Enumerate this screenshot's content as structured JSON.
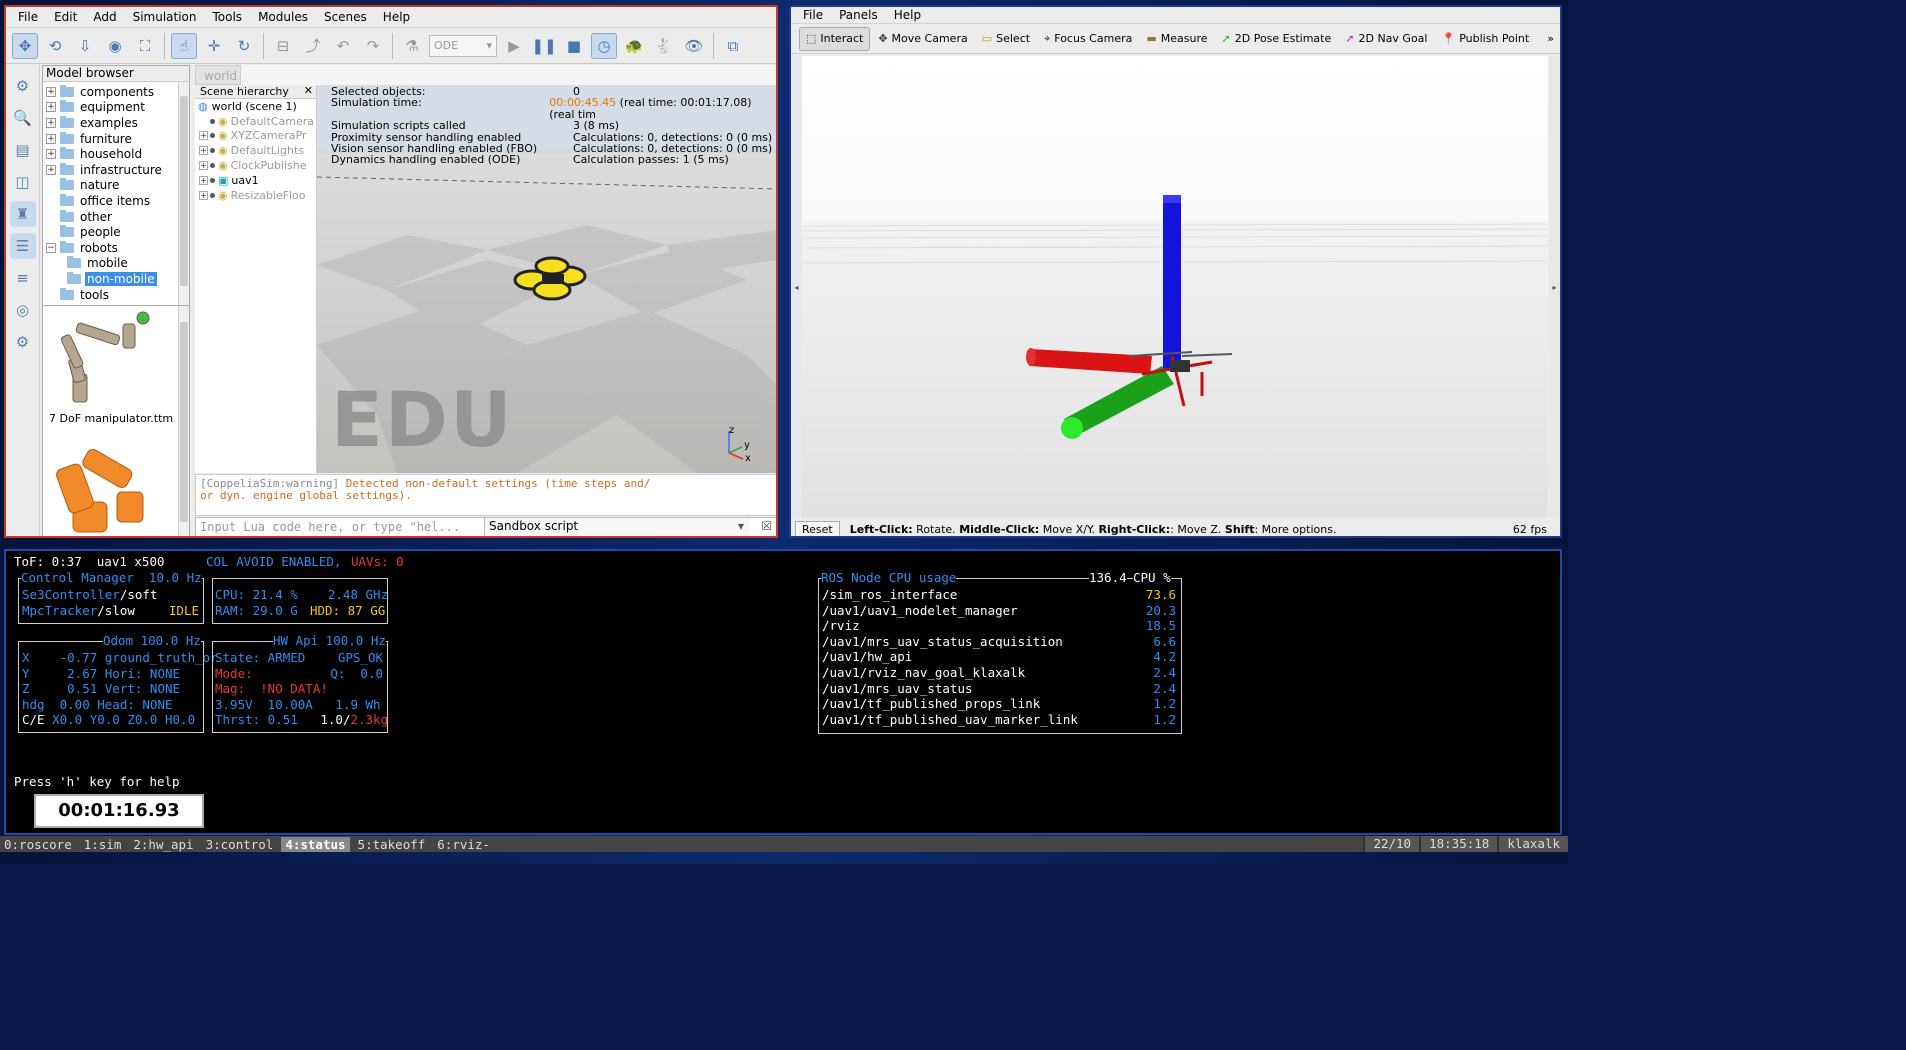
{
  "coppelia": {
    "menu": [
      "File",
      "Edit",
      "Add",
      "Simulation",
      "Tools",
      "Modules",
      "Scenes",
      "Help"
    ],
    "engine": "ODE",
    "model_browser": {
      "title": "Model browser",
      "items": [
        {
          "label": "components",
          "exp": "+"
        },
        {
          "label": "equipment",
          "exp": "+"
        },
        {
          "label": "examples",
          "exp": "+"
        },
        {
          "label": "furniture",
          "exp": "+"
        },
        {
          "label": "household",
          "exp": "+"
        },
        {
          "label": "infrastructure",
          "exp": "+"
        },
        {
          "label": "nature",
          "exp": ""
        },
        {
          "label": "office items",
          "exp": ""
        },
        {
          "label": "other",
          "exp": ""
        },
        {
          "label": "people",
          "exp": ""
        },
        {
          "label": "robots",
          "exp": "−"
        },
        {
          "label": "mobile",
          "exp": "",
          "indent": true
        },
        {
          "label": "non-mobile",
          "exp": "",
          "indent": true,
          "selected": true
        },
        {
          "label": "tools",
          "exp": ""
        }
      ],
      "thumb_label": "7 DoF manipulator.ttm"
    },
    "scene_tab": "world",
    "hierarchy": {
      "title": "Scene hierarchy",
      "rows": [
        {
          "label": "world (scene 1)",
          "main": true
        },
        {
          "label": "DefaultCamera"
        },
        {
          "label": "XYZCameraPr"
        },
        {
          "label": "DefaultLights"
        },
        {
          "label": "ClockPublishe"
        },
        {
          "label": "uav1",
          "main": true
        },
        {
          "label": "ResizableFloo"
        }
      ]
    },
    "info": [
      {
        "k": "Selected objects:",
        "v": "0"
      },
      {
        "k": "Simulation time:",
        "v_orange": "00:00:45.45",
        "v": " (real time: 00:01:17.08) (real tim"
      },
      {
        "k": "Simulation scripts called",
        "v": "3 (8 ms)"
      },
      {
        "k": "Proximity sensor handling enabled",
        "v": "Calculations: 0, detections: 0 (0 ms)"
      },
      {
        "k": "Vision sensor handling enabled (FBO)",
        "v": "Calculations: 0, detections: 0 (0 ms)"
      },
      {
        "k": "Dynamics handling enabled (ODE)",
        "v": "Calculation passes: 1 (5 ms)"
      }
    ],
    "watermark": "EDU",
    "axes": {
      "z": "z",
      "y": "y",
      "x": "x"
    },
    "console_prefix": "[CoppeliaSim:warning]",
    "console_msg1": " Detected non-default settings (time steps and/",
    "console_msg2": "or dyn. engine global settings).",
    "lua_placeholder": "Input Lua code here, or type \"hel...",
    "sandbox": "Sandbox script"
  },
  "rviz": {
    "menu": [
      "File",
      "Panels",
      "Help"
    ],
    "tools": [
      {
        "label": "Interact",
        "icon": "cursor-icon"
      },
      {
        "label": "Move Camera",
        "icon": "move-camera-icon"
      },
      {
        "label": "Select",
        "icon": "select-icon"
      },
      {
        "label": "Focus Camera",
        "icon": "focus-icon"
      },
      {
        "label": "Measure",
        "icon": "ruler-icon"
      },
      {
        "label": "2D Pose Estimate",
        "icon": "pose-arrow-icon"
      },
      {
        "label": "2D Nav Goal",
        "icon": "nav-arrow-icon"
      },
      {
        "label": "Publish Point",
        "icon": "pin-icon"
      }
    ],
    "reset": "Reset",
    "help_parts": [
      [
        "b",
        "Left-Click:"
      ],
      [
        "t",
        " Rotate. "
      ],
      [
        "b",
        "Middle-Click:"
      ],
      [
        "t",
        " Move X/Y. "
      ],
      [
        "b",
        "Right-Click:"
      ],
      [
        "t",
        ": Move Z. "
      ],
      [
        "b",
        "Shift"
      ],
      [
        "t",
        ": More options."
      ]
    ],
    "fps": "62 fps"
  },
  "terminal": {
    "tof": "ToF: 0:37  uav1 x500",
    "colavoid": "COL AVOID ENABLED,",
    "uavs": "UAVs: 0",
    "control": {
      "title": "Control Manager  10.0 Hz",
      "c1": "Se3Controller",
      "c1s": "/soft",
      "c2": "MpcTracker",
      "c2s": "/slow",
      "state": "IDLE"
    },
    "sys": {
      "cpu": "CPU: 21.4 %    2.48 GHz",
      "ram": "RAM: 29.0 G",
      "hdd": "HDD: 87 GG"
    },
    "odom": {
      "title": "Odom 100.0 Hz",
      "rows": [
        "X    -0.77 ground_truth_or",
        "Y     2.67 Hori: NONE",
        "Z     0.51 Vert: NONE",
        "hdg  0.00 Head: NONE"
      ],
      "ce_label": "C/E",
      "ce": " X0.0 Y0.0 Z0.0 H0.0"
    },
    "hw": {
      "title": "HW Api 100.0 Hz",
      "state": "State: ARMED",
      "gps": "GPS_OK",
      "mode": "Mode:",
      "q": "Q:  0.0",
      "mag": "Mag:  !NO DATA!",
      "power": "3.95V  10.00A   1.9 Wh",
      "thrst": "Thrst: 0.51",
      "mass1": "1.0/",
      "mass2": "2.3kg"
    },
    "cpu": {
      "title": "ROS Node CPU usage",
      "total": "136.4",
      "unit": "CPU %",
      "nodes": [
        {
          "n": "/sim_ros_interface",
          "v": "73.6",
          "hi": true
        },
        {
          "n": "/uav1/uav1_nodelet_manager",
          "v": "20.3"
        },
        {
          "n": "/rviz",
          "v": "18.5"
        },
        {
          "n": "/uav1/mrs_uav_status_acquisition",
          "v": "6.6"
        },
        {
          "n": "/uav1/hw_api",
          "v": "4.2"
        },
        {
          "n": "/uav1/rviz_nav_goal_klaxalk",
          "v": "2.4"
        },
        {
          "n": "/uav1/mrs_uav_status",
          "v": "2.4"
        },
        {
          "n": "/uav1/tf_published_props_link",
          "v": "1.2"
        },
        {
          "n": "/uav1/tf_published_uav_marker_link",
          "v": "1.2"
        }
      ]
    },
    "help": "Press 'h' key for help",
    "timer": "00:01:16.93"
  },
  "tmux": {
    "windows": [
      "0:roscore",
      "1:sim",
      "2:hw_api",
      "3:control",
      "4:status",
      "5:takeoff",
      "6:rviz-"
    ],
    "active": 4,
    "date": "22/10",
    "time": "18:35:18",
    "user": "klaxalk"
  }
}
